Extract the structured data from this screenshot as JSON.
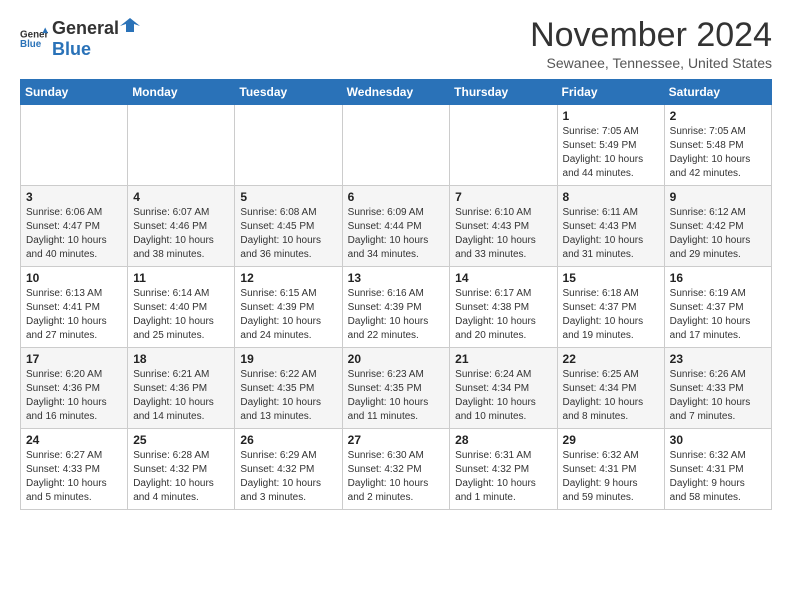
{
  "header": {
    "logo_general": "General",
    "logo_blue": "Blue",
    "month_title": "November 2024",
    "location": "Sewanee, Tennessee, United States"
  },
  "days_of_week": [
    "Sunday",
    "Monday",
    "Tuesday",
    "Wednesday",
    "Thursday",
    "Friday",
    "Saturday"
  ],
  "weeks": [
    [
      {
        "day": "",
        "info": ""
      },
      {
        "day": "",
        "info": ""
      },
      {
        "day": "",
        "info": ""
      },
      {
        "day": "",
        "info": ""
      },
      {
        "day": "",
        "info": ""
      },
      {
        "day": "1",
        "info": "Sunrise: 7:05 AM\nSunset: 5:49 PM\nDaylight: 10 hours\nand 44 minutes."
      },
      {
        "day": "2",
        "info": "Sunrise: 7:05 AM\nSunset: 5:48 PM\nDaylight: 10 hours\nand 42 minutes."
      }
    ],
    [
      {
        "day": "3",
        "info": "Sunrise: 6:06 AM\nSunset: 4:47 PM\nDaylight: 10 hours\nand 40 minutes."
      },
      {
        "day": "4",
        "info": "Sunrise: 6:07 AM\nSunset: 4:46 PM\nDaylight: 10 hours\nand 38 minutes."
      },
      {
        "day": "5",
        "info": "Sunrise: 6:08 AM\nSunset: 4:45 PM\nDaylight: 10 hours\nand 36 minutes."
      },
      {
        "day": "6",
        "info": "Sunrise: 6:09 AM\nSunset: 4:44 PM\nDaylight: 10 hours\nand 34 minutes."
      },
      {
        "day": "7",
        "info": "Sunrise: 6:10 AM\nSunset: 4:43 PM\nDaylight: 10 hours\nand 33 minutes."
      },
      {
        "day": "8",
        "info": "Sunrise: 6:11 AM\nSunset: 4:43 PM\nDaylight: 10 hours\nand 31 minutes."
      },
      {
        "day": "9",
        "info": "Sunrise: 6:12 AM\nSunset: 4:42 PM\nDaylight: 10 hours\nand 29 minutes."
      }
    ],
    [
      {
        "day": "10",
        "info": "Sunrise: 6:13 AM\nSunset: 4:41 PM\nDaylight: 10 hours\nand 27 minutes."
      },
      {
        "day": "11",
        "info": "Sunrise: 6:14 AM\nSunset: 4:40 PM\nDaylight: 10 hours\nand 25 minutes."
      },
      {
        "day": "12",
        "info": "Sunrise: 6:15 AM\nSunset: 4:39 PM\nDaylight: 10 hours\nand 24 minutes."
      },
      {
        "day": "13",
        "info": "Sunrise: 6:16 AM\nSunset: 4:39 PM\nDaylight: 10 hours\nand 22 minutes."
      },
      {
        "day": "14",
        "info": "Sunrise: 6:17 AM\nSunset: 4:38 PM\nDaylight: 10 hours\nand 20 minutes."
      },
      {
        "day": "15",
        "info": "Sunrise: 6:18 AM\nSunset: 4:37 PM\nDaylight: 10 hours\nand 19 minutes."
      },
      {
        "day": "16",
        "info": "Sunrise: 6:19 AM\nSunset: 4:37 PM\nDaylight: 10 hours\nand 17 minutes."
      }
    ],
    [
      {
        "day": "17",
        "info": "Sunrise: 6:20 AM\nSunset: 4:36 PM\nDaylight: 10 hours\nand 16 minutes."
      },
      {
        "day": "18",
        "info": "Sunrise: 6:21 AM\nSunset: 4:36 PM\nDaylight: 10 hours\nand 14 minutes."
      },
      {
        "day": "19",
        "info": "Sunrise: 6:22 AM\nSunset: 4:35 PM\nDaylight: 10 hours\nand 13 minutes."
      },
      {
        "day": "20",
        "info": "Sunrise: 6:23 AM\nSunset: 4:35 PM\nDaylight: 10 hours\nand 11 minutes."
      },
      {
        "day": "21",
        "info": "Sunrise: 6:24 AM\nSunset: 4:34 PM\nDaylight: 10 hours\nand 10 minutes."
      },
      {
        "day": "22",
        "info": "Sunrise: 6:25 AM\nSunset: 4:34 PM\nDaylight: 10 hours\nand 8 minutes."
      },
      {
        "day": "23",
        "info": "Sunrise: 6:26 AM\nSunset: 4:33 PM\nDaylight: 10 hours\nand 7 minutes."
      }
    ],
    [
      {
        "day": "24",
        "info": "Sunrise: 6:27 AM\nSunset: 4:33 PM\nDaylight: 10 hours\nand 5 minutes."
      },
      {
        "day": "25",
        "info": "Sunrise: 6:28 AM\nSunset: 4:32 PM\nDaylight: 10 hours\nand 4 minutes."
      },
      {
        "day": "26",
        "info": "Sunrise: 6:29 AM\nSunset: 4:32 PM\nDaylight: 10 hours\nand 3 minutes."
      },
      {
        "day": "27",
        "info": "Sunrise: 6:30 AM\nSunset: 4:32 PM\nDaylight: 10 hours\nand 2 minutes."
      },
      {
        "day": "28",
        "info": "Sunrise: 6:31 AM\nSunset: 4:32 PM\nDaylight: 10 hours\nand 1 minute."
      },
      {
        "day": "29",
        "info": "Sunrise: 6:32 AM\nSunset: 4:31 PM\nDaylight: 9 hours\nand 59 minutes."
      },
      {
        "day": "30",
        "info": "Sunrise: 6:32 AM\nSunset: 4:31 PM\nDaylight: 9 hours\nand 58 minutes."
      }
    ]
  ]
}
